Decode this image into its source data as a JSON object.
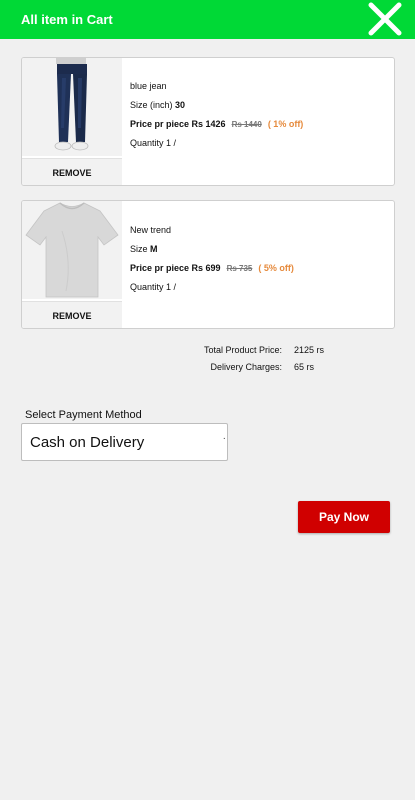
{
  "header": {
    "title": "All item in Cart",
    "close_icon": "close-icon",
    "color": "#00d936"
  },
  "cart": {
    "items": [
      {
        "name": "blue jean",
        "size_label": "Size (inch)",
        "size_value": "30",
        "price_label": "Price pr piece Rs 1426",
        "original_price": "Rs 1440",
        "discount": "( 1% off)",
        "quantity": "Quantity 1 /",
        "remove_label": "REMOVE",
        "image_icon": "jeans-image"
      },
      {
        "name": "New trend",
        "size_label": "Size",
        "size_value": "M",
        "price_label": "Price pr piece Rs 699",
        "original_price": "Rs 735",
        "discount": "( 5% off)",
        "quantity": "Quantity 1 /",
        "remove_label": "REMOVE",
        "image_icon": "tshirt-image"
      }
    ]
  },
  "summary": {
    "total_label": "Total Product Price:",
    "total_value": "2125 rs",
    "delivery_label": "Delivery Charges:",
    "delivery_value": "65 rs"
  },
  "payment": {
    "label": "Select Payment Method",
    "selected": "Cash on Delivery"
  },
  "pay_button": {
    "label": "Pay Now",
    "color": "#d00000"
  }
}
